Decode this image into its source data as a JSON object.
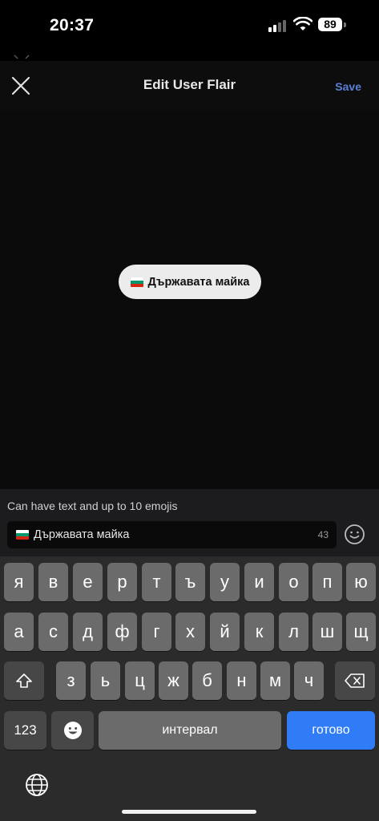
{
  "status_bar": {
    "time": "20:37",
    "battery": "89"
  },
  "nav": {
    "title": "Edit User Flair",
    "save_label": "Save"
  },
  "flair": {
    "text": "Държавата майка"
  },
  "input": {
    "hint": "Can have text and up to 10 emojis",
    "value": "Държавата майка",
    "char_count": "43"
  },
  "keyboard": {
    "row1": [
      "я",
      "в",
      "е",
      "р",
      "т",
      "ъ",
      "у",
      "и",
      "о",
      "п",
      "ю"
    ],
    "row2": [
      "а",
      "с",
      "д",
      "ф",
      "г",
      "х",
      "й",
      "к",
      "л",
      "ш",
      "щ"
    ],
    "row3": [
      "з",
      "ь",
      "ц",
      "ж",
      "б",
      "н",
      "м",
      "ч"
    ],
    "numbers_label": "123",
    "space_label": "интервал",
    "return_label": "готово"
  },
  "icons": {
    "close": "close-icon",
    "emoji": "emoji-icon",
    "shift": "shift-icon",
    "delete": "delete-icon",
    "globe": "globe-icon",
    "wifi": "wifi-icon",
    "signal": "signal-icon",
    "flag": "bulgaria-flag-icon"
  },
  "colors": {
    "accent": "#5b7fd8",
    "return_key": "#2f7cf6",
    "flair_bg": "#ececec"
  }
}
